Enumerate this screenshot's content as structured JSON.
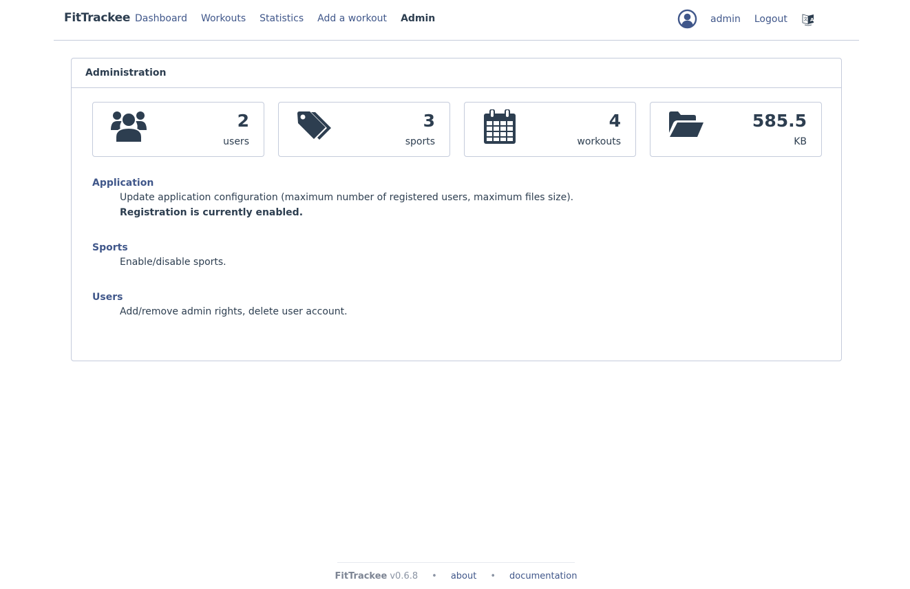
{
  "app": {
    "brand": "FitTrackee"
  },
  "nav": {
    "links": [
      {
        "label": "Dashboard",
        "active": false
      },
      {
        "label": "Workouts",
        "active": false
      },
      {
        "label": "Statistics",
        "active": false
      },
      {
        "label": "Add a workout",
        "active": false
      },
      {
        "label": "Admin",
        "active": true
      }
    ],
    "user_icon": "user-circle-icon",
    "username": "admin",
    "logout": "Logout",
    "language_icon": "language-icon"
  },
  "admin": {
    "title": "Administration",
    "stats": [
      {
        "icon": "users-icon",
        "value": "2",
        "label": "users"
      },
      {
        "icon": "tags-icon",
        "value": "3",
        "label": "sports"
      },
      {
        "icon": "calendar-icon",
        "value": "4",
        "label": "workouts"
      },
      {
        "icon": "folder-open-icon",
        "value": "585.5",
        "label": "KB"
      }
    ],
    "sections": [
      {
        "title": "Application",
        "description": "Update application configuration (maximum number of registered users, maximum files size).",
        "status": "Registration is currently enabled."
      },
      {
        "title": "Sports",
        "description": "Enable/disable sports."
      },
      {
        "title": "Users",
        "description": "Add/remove admin rights, delete user account."
      }
    ]
  },
  "footer": {
    "brand": "FitTrackee",
    "version": "v0.6.8",
    "separator": "•",
    "about": "about",
    "documentation": "documentation"
  },
  "colors": {
    "primary_text": "#2d3e50",
    "link": "#40578a",
    "border": "#c4cbdb"
  }
}
